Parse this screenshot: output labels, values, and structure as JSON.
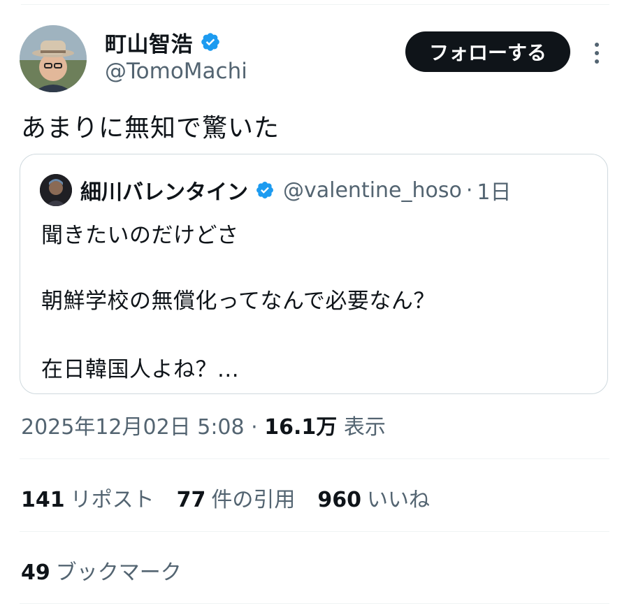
{
  "author": {
    "display_name": "町山智浩",
    "handle": "@TomoMachi",
    "verified_icon": "verified-badge-icon",
    "verified_color": "#1d9bf0"
  },
  "follow_button": {
    "label": "フォローする"
  },
  "more_icon": "more-dots-icon",
  "tweet": {
    "text": "あまりに無知で驚いた"
  },
  "quote": {
    "display_name": "細川バレンタイン",
    "handle": "@valentine_hoso",
    "separator": "·",
    "time_ago": "1日",
    "lines": [
      "聞きたいのだけどさ",
      "朝鮮学校の無償化ってなんで必要なん？",
      "在日韓国人よね？..."
    ]
  },
  "meta": {
    "timestamp": "2025年12月02日 5:08",
    "separator": "·",
    "views_count": "16.1万",
    "views_label": "表示"
  },
  "stats": {
    "reposts_count": "141",
    "reposts_label": "リポスト",
    "quotes_count": "77",
    "quotes_label": "件の引用",
    "likes_count": "960",
    "likes_label": "いいね",
    "bookmarks_count": "49",
    "bookmarks_label": "ブックマーク"
  },
  "colors": {
    "text_primary": "#0f1419",
    "text_secondary": "#536471",
    "divider": "#eff3f4",
    "button_bg": "#0f1419"
  }
}
